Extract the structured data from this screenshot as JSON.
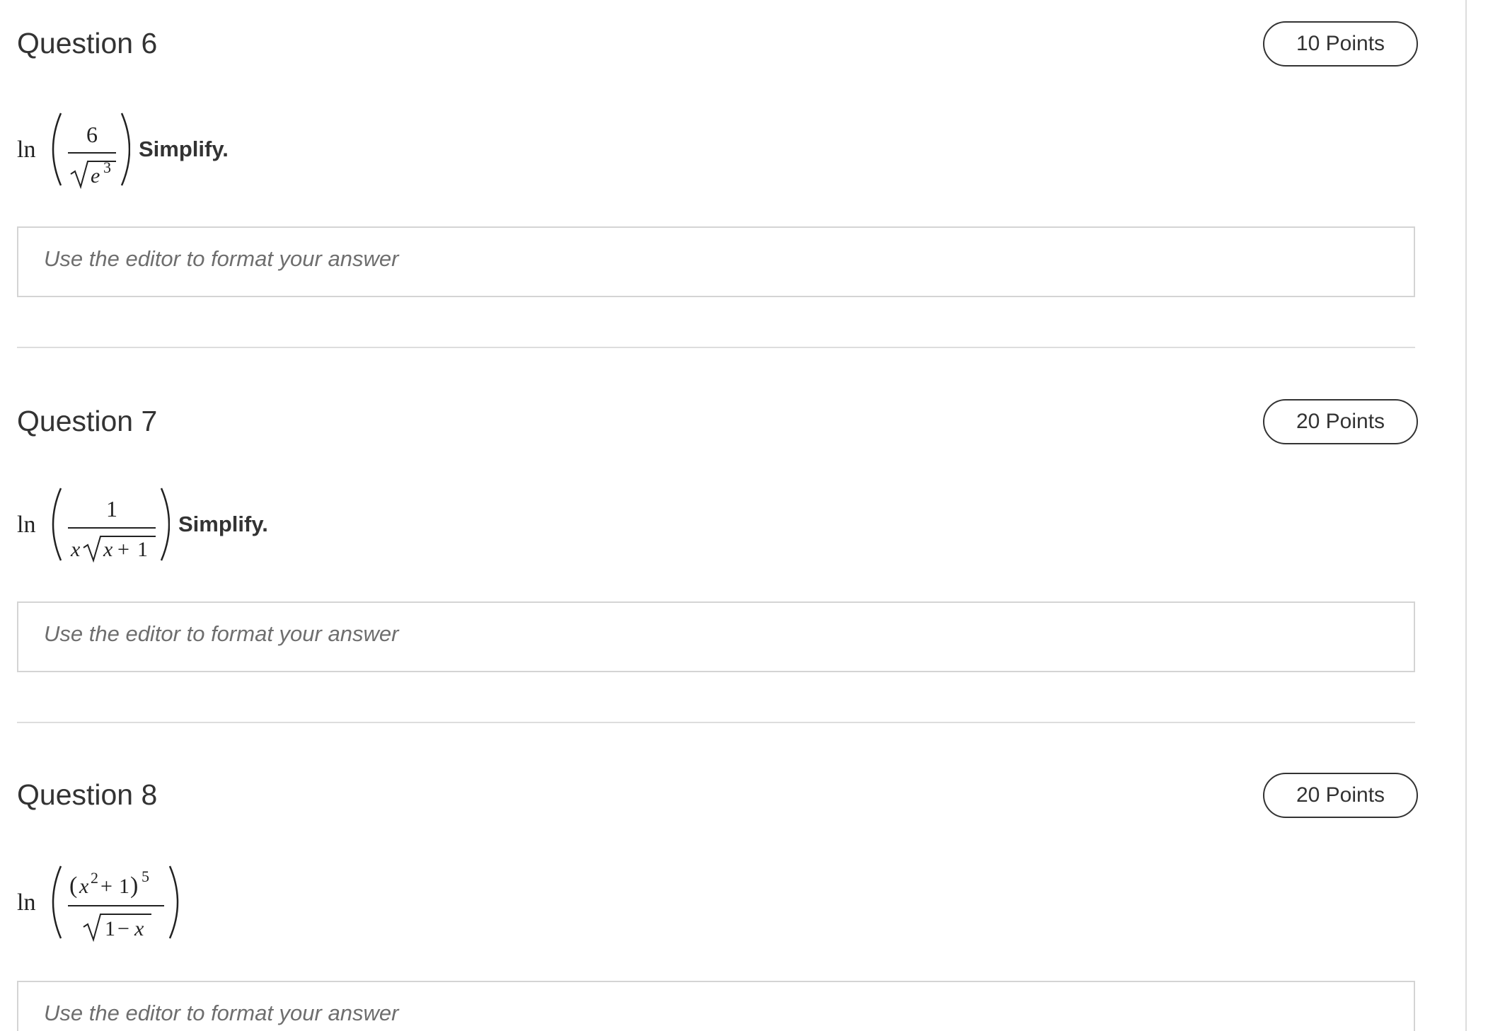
{
  "questions": [
    {
      "title": "Question 6",
      "points": "10 Points",
      "formula": "ln(6 / √(e^3))",
      "instruction": "Simplify.",
      "answer_placeholder": "Use the editor to format your answer"
    },
    {
      "title": "Question 7",
      "points": "20 Points",
      "formula": "ln(1 / (x√(x+1)))",
      "instruction": "Simplify.",
      "answer_placeholder": "Use the editor to format your answer"
    },
    {
      "title": "Question 8",
      "points": "20 Points",
      "formula": "ln((x^2+1)^5 / √(1−x))",
      "instruction": "",
      "answer_placeholder": "Use the editor to format your answer"
    }
  ],
  "colors": {
    "text": "#333333",
    "placeholder": "#6e6e6e",
    "border": "#d4d4d4",
    "divider": "#dddddd"
  }
}
